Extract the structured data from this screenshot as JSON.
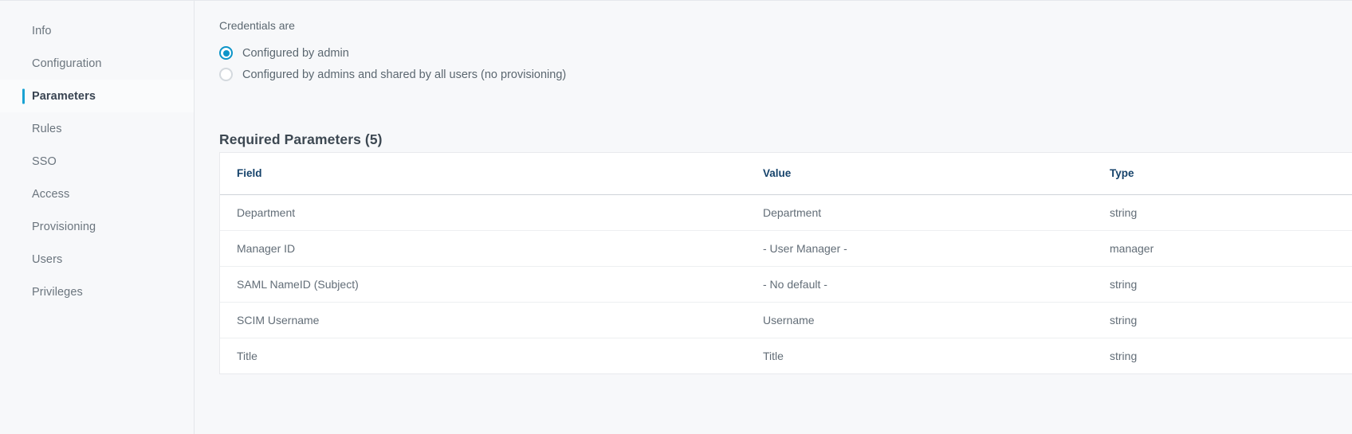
{
  "sidebar": {
    "items": [
      {
        "label": "Info",
        "active": false
      },
      {
        "label": "Configuration",
        "active": false
      },
      {
        "label": "Parameters",
        "active": true
      },
      {
        "label": "Rules",
        "active": false
      },
      {
        "label": "SSO",
        "active": false
      },
      {
        "label": "Access",
        "active": false
      },
      {
        "label": "Provisioning",
        "active": false
      },
      {
        "label": "Users",
        "active": false
      },
      {
        "label": "Privileges",
        "active": false
      }
    ],
    "active_accent_color": "#19a2d3"
  },
  "main": {
    "credentials_label": "Credentials are",
    "credentials_options": [
      {
        "label": "Configured by admin",
        "selected": true
      },
      {
        "label": "Configured by admins and shared by all users (no provisioning)",
        "selected": false
      }
    ],
    "radio_selected_color": "#0d95c9",
    "table_heading": "Required Parameters (5)",
    "table": {
      "columns": [
        "Field",
        "Value",
        "Type"
      ],
      "header_color": "#16436b",
      "rows": [
        {
          "field": "Department",
          "value": "Department",
          "type": "string"
        },
        {
          "field": "Manager ID",
          "value": "- User Manager -",
          "type": "manager"
        },
        {
          "field": "SAML NameID (Subject)",
          "value": "- No default -",
          "type": "string"
        },
        {
          "field": "SCIM Username",
          "value": "Username",
          "type": "string"
        },
        {
          "field": "Title",
          "value": "Title",
          "type": "string"
        }
      ]
    }
  }
}
